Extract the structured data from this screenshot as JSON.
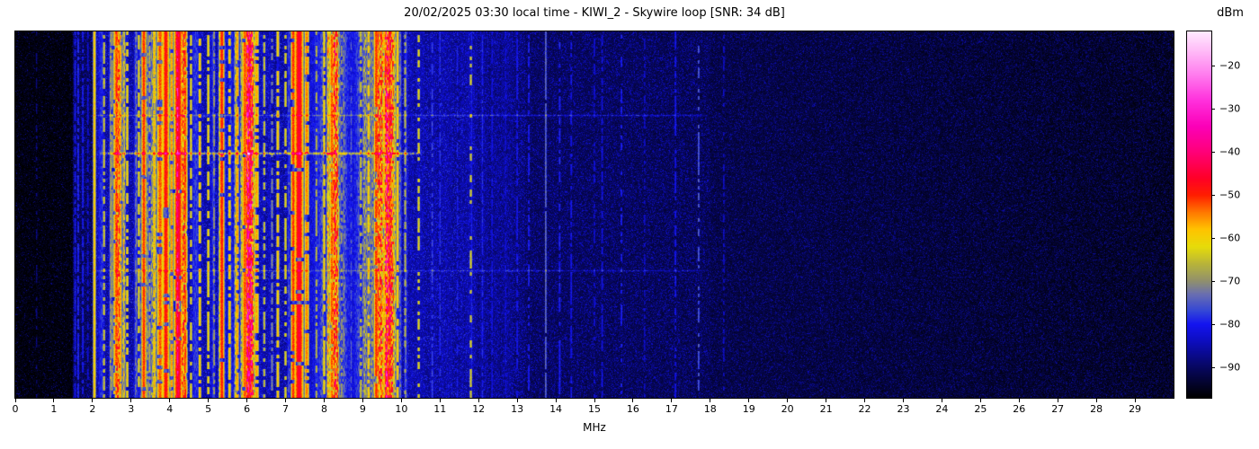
{
  "figure": {
    "title": "20/02/2025 03:30 local time - KIWI_2 - Skywire loop [SNR: 34 dB]",
    "xlabel": "MHz",
    "colorbar_label": "dBm",
    "background": "#ffffff"
  },
  "chart_data": {
    "type": "heatmap",
    "subtype": "radio-spectrogram-waterfall",
    "title": "20/02/2025 03:30 local time - KIWI_2 - Skywire loop [SNR: 34 dB]",
    "xlabel": "MHz",
    "ylabel": "",
    "x_range": [
      0,
      30
    ],
    "x_ticks": [
      0,
      1,
      2,
      3,
      4,
      5,
      6,
      7,
      8,
      9,
      10,
      11,
      12,
      13,
      14,
      15,
      16,
      17,
      18,
      19,
      20,
      21,
      22,
      23,
      24,
      25,
      26,
      27,
      28,
      29
    ],
    "grid": false,
    "legend": "none",
    "colorbar": {
      "label": "dBm",
      "ticks": [
        -20,
        -30,
        -40,
        -50,
        -60,
        -70,
        -80,
        -90
      ],
      "vmin": -97,
      "vmax": -12,
      "position": "right"
    },
    "colormap_stops": [
      [
        -97,
        "#000000"
      ],
      [
        -90,
        "#070760"
      ],
      [
        -84,
        "#0d0dbe"
      ],
      [
        -80,
        "#1414f0"
      ],
      [
        -77,
        "#3345d8"
      ],
      [
        -73,
        "#6a6fb0"
      ],
      [
        -70,
        "#90906e"
      ],
      [
        -66,
        "#b8b43a"
      ],
      [
        -62,
        "#e6dc0a"
      ],
      [
        -58,
        "#ffc400"
      ],
      [
        -54,
        "#ff7800"
      ],
      [
        -50,
        "#ff1e00"
      ],
      [
        -46,
        "#ff0028"
      ],
      [
        -40,
        "#ff0078"
      ],
      [
        -34,
        "#fb00b8"
      ],
      [
        -28,
        "#ff30dc"
      ],
      [
        -22,
        "#ff7cee"
      ],
      [
        -16,
        "#ffc0f8"
      ],
      [
        -12,
        "#ffeaff"
      ]
    ],
    "noise_floor_bands": [
      {
        "f0": 0.0,
        "f1": 1.5,
        "floor0": -96.0,
        "floor1": -96.0,
        "dot_prob": 0.07,
        "dot_amp": 6
      },
      {
        "f0": 1.5,
        "f1": 2.1,
        "floor0": -91.0,
        "floor1": -91.0,
        "dot_prob": 0.2,
        "dot_amp": 6
      },
      {
        "f0": 2.1,
        "f1": 10.2,
        "floor0": -86.5,
        "floor1": -86.5,
        "dot_prob": 0.28,
        "dot_amp": 6
      },
      {
        "f0": 10.2,
        "f1": 11.9,
        "floor0": -87.0,
        "floor1": -87.5,
        "dot_prob": 0.3,
        "dot_amp": 6
      },
      {
        "f0": 11.9,
        "f1": 13.2,
        "floor0": -88.5,
        "floor1": -89.5,
        "dot_prob": 0.28,
        "dot_amp": 6
      },
      {
        "f0": 13.2,
        "f1": 18.0,
        "floor0": -90.5,
        "floor1": -91.5,
        "dot_prob": 0.24,
        "dot_amp": 5
      },
      {
        "f0": 18.0,
        "f1": 30.0,
        "floor0": -92.0,
        "floor1": -94.5,
        "dot_prob": 0.18,
        "dot_amp": 4
      }
    ],
    "broadcast_band": {
      "f0": 2.1,
      "f1": 10.2,
      "envelope_peaks": [
        2.65,
        3.35,
        4.2,
        5.35,
        6.05,
        7.35,
        8.2,
        9.6
      ],
      "envelope_dips": [
        3.0,
        4.9,
        6.6,
        7.9,
        8.7
      ],
      "max_boost_db": 46
    },
    "signals": [
      [
        0.55,
        -88,
        1,
        0.4
      ],
      [
        1.55,
        -80,
        1,
        0.8
      ],
      [
        1.63,
        -78,
        1,
        0.85
      ],
      [
        1.75,
        -79,
        1,
        0.7
      ],
      [
        1.88,
        -82,
        1,
        0.6
      ],
      [
        2.05,
        -58,
        1,
        1.0
      ],
      [
        2.3,
        -64,
        1,
        0.7
      ],
      [
        2.5,
        -70,
        2,
        0.8
      ],
      [
        2.62,
        -52,
        2,
        0.85
      ],
      [
        2.72,
        -55,
        1,
        0.8
      ],
      [
        2.9,
        -60,
        1,
        0.6
      ],
      [
        3.2,
        -62,
        1,
        0.7
      ],
      [
        3.33,
        -50,
        1.5,
        0.9
      ],
      [
        3.48,
        -66,
        1,
        0.6
      ],
      [
        3.6,
        -57,
        1,
        0.8
      ],
      [
        3.75,
        -52,
        2,
        0.85
      ],
      [
        3.9,
        -48,
        2,
        0.9
      ],
      [
        4.05,
        -55,
        1,
        0.8
      ],
      [
        4.22,
        -45,
        2.5,
        0.95
      ],
      [
        4.4,
        -52,
        1.5,
        0.8
      ],
      [
        4.55,
        -62,
        1,
        0.6
      ],
      [
        4.78,
        -58,
        1,
        0.7
      ],
      [
        5.0,
        -60,
        1,
        0.75
      ],
      [
        5.15,
        -68,
        1,
        0.6
      ],
      [
        5.35,
        -49,
        1.5,
        0.9
      ],
      [
        5.55,
        -58,
        1,
        0.7
      ],
      [
        5.75,
        -55,
        1,
        0.8
      ],
      [
        5.95,
        -52,
        2,
        0.9
      ],
      [
        6.07,
        -50,
        2,
        0.9
      ],
      [
        6.25,
        -56,
        1.5,
        0.8
      ],
      [
        6.45,
        -64,
        1,
        0.6
      ],
      [
        6.65,
        -70,
        1,
        0.5
      ],
      [
        6.8,
        -58,
        1,
        0.75
      ],
      [
        7.0,
        -62,
        1,
        0.6
      ],
      [
        7.2,
        -50,
        1.5,
        0.9
      ],
      [
        7.35,
        -45,
        2.5,
        0.95
      ],
      [
        7.55,
        -54,
        1.5,
        0.8
      ],
      [
        7.8,
        -66,
        1,
        0.6
      ],
      [
        8.0,
        -60,
        1,
        0.7
      ],
      [
        8.2,
        -52,
        1.5,
        0.85
      ],
      [
        8.45,
        -68,
        1,
        0.5
      ],
      [
        8.7,
        -74,
        1,
        0.5
      ],
      [
        8.95,
        -64,
        1,
        0.6
      ],
      [
        9.15,
        -58,
        1,
        0.7
      ],
      [
        9.35,
        -50,
        1.5,
        0.85
      ],
      [
        9.55,
        -56,
        1,
        0.8
      ],
      [
        9.7,
        -52,
        1.5,
        0.85
      ],
      [
        9.9,
        -58,
        1,
        0.8
      ],
      [
        10.1,
        -66,
        1,
        0.6
      ],
      [
        10.45,
        -62,
        1,
        0.45
      ],
      [
        10.8,
        -76,
        1,
        0.5
      ],
      [
        11.0,
        -78,
        1,
        0.6
      ],
      [
        11.45,
        -80,
        1,
        0.6
      ],
      [
        11.8,
        -64,
        1,
        0.33
      ],
      [
        11.82,
        -80,
        1,
        1.0
      ],
      [
        12.1,
        -79,
        1,
        0.7
      ],
      [
        12.35,
        -81,
        1,
        0.7
      ],
      [
        12.7,
        -82,
        1,
        0.6
      ],
      [
        13.0,
        -80,
        1,
        0.7
      ],
      [
        13.3,
        -79,
        1,
        0.6
      ],
      [
        13.74,
        -72,
        0.7,
        0.95
      ],
      [
        14.1,
        -79,
        1,
        0.6
      ],
      [
        14.4,
        -80,
        1,
        0.6
      ],
      [
        15.0,
        -82,
        1,
        0.5
      ],
      [
        15.2,
        -81,
        1,
        0.6
      ],
      [
        15.7,
        -79,
        1,
        0.35
      ],
      [
        16.3,
        -83,
        1,
        0.5
      ],
      [
        17.1,
        -80,
        1,
        0.6
      ],
      [
        17.7,
        -73,
        0.7,
        0.55
      ],
      [
        18.35,
        -83,
        1,
        0.5
      ]
    ],
    "horizontal_events": [
      {
        "row_frac": 0.332,
        "f0": 2.1,
        "f1": 10.6,
        "boost": 17,
        "half_thickness": 2.0,
        "note": "strong wideband burst"
      },
      {
        "row_frac": 0.228,
        "f0": 1.9,
        "f1": 18.0,
        "boost": 7,
        "half_thickness": 1.4,
        "note": "faint burst line"
      },
      {
        "row_frac": 0.652,
        "f0": 1.9,
        "f1": 18.0,
        "boost": 6,
        "half_thickness": 1.4,
        "note": "faint burst line"
      }
    ]
  },
  "axes": {
    "x_tick_values": [
      0,
      1,
      2,
      3,
      4,
      5,
      6,
      7,
      8,
      9,
      10,
      11,
      12,
      13,
      14,
      15,
      16,
      17,
      18,
      19,
      20,
      21,
      22,
      23,
      24,
      25,
      26,
      27,
      28,
      29
    ],
    "colorbar_tick_values": [
      -20,
      -30,
      -40,
      -50,
      -60,
      -70,
      -80,
      -90
    ]
  }
}
